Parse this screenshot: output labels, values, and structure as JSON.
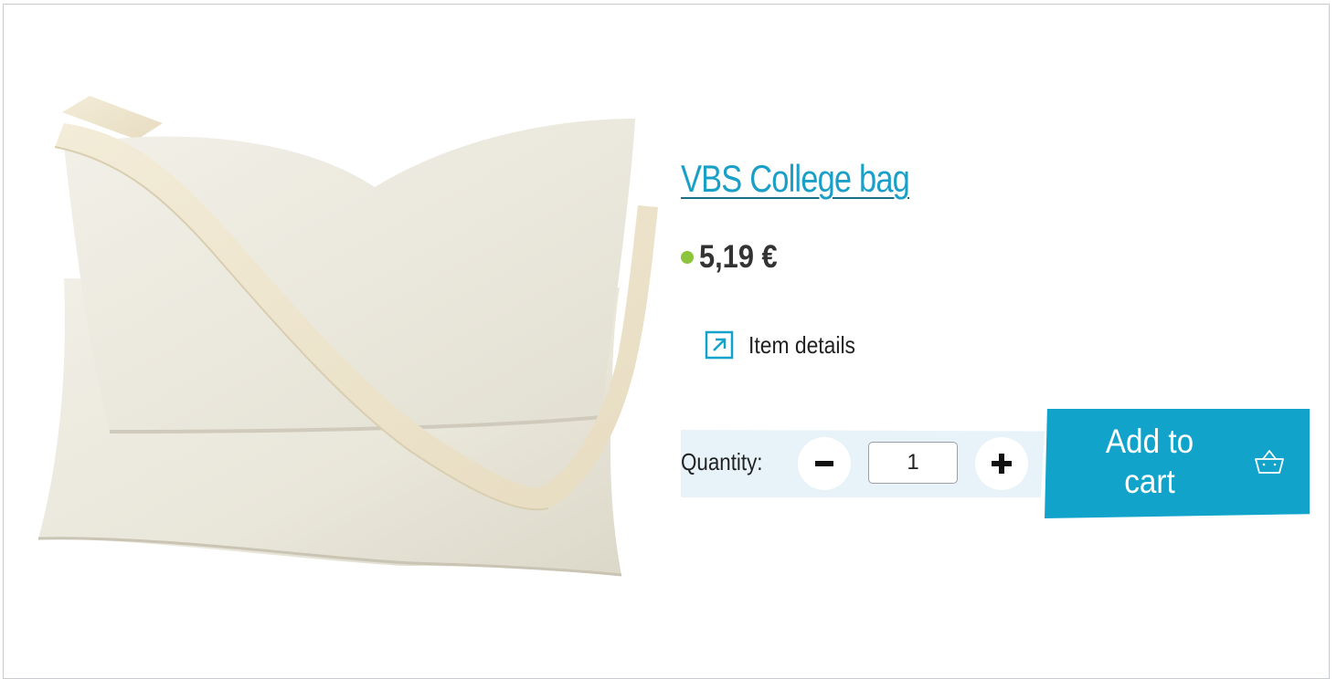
{
  "product": {
    "title": "VBS College bag",
    "price": "5,19 €",
    "stock_status_color": "#8cc43c",
    "details_link_label": "Item details",
    "image_icon": "cotton-shoulder-bag-image"
  },
  "quantity": {
    "label": "Quantity:",
    "value": "1",
    "decrease_icon": "minus-icon",
    "increase_icon": "plus-icon"
  },
  "cart": {
    "button_label": "Add to cart",
    "icon": "basket-icon"
  },
  "colors": {
    "accent": "#11a3c9",
    "link": "#1a9fc7",
    "quantity_background": "#e7f3f8"
  }
}
